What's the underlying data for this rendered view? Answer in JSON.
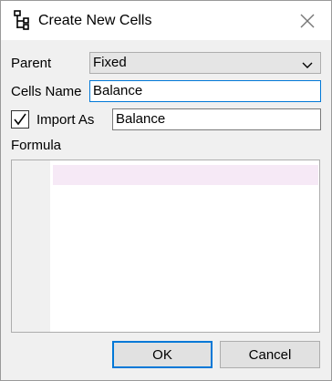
{
  "window": {
    "title": "Create New Cells"
  },
  "icons": {
    "app": "tree-hierarchy-icon",
    "close": "close-icon",
    "dropdown": "chevron-down-icon",
    "check": "checkmark-icon"
  },
  "form": {
    "parent_label": "Parent",
    "parent_value": "Fixed",
    "cells_name_label": "Cells Name",
    "cells_name_value": "Balance",
    "import_as_label": "Import As",
    "import_as_checked": true,
    "import_as_value": "Balance",
    "formula_label": "Formula",
    "formula_value": ""
  },
  "buttons": {
    "ok": "OK",
    "cancel": "Cancel"
  },
  "colors": {
    "accent": "#0078d7",
    "line_highlight": "#f6e9f6"
  }
}
